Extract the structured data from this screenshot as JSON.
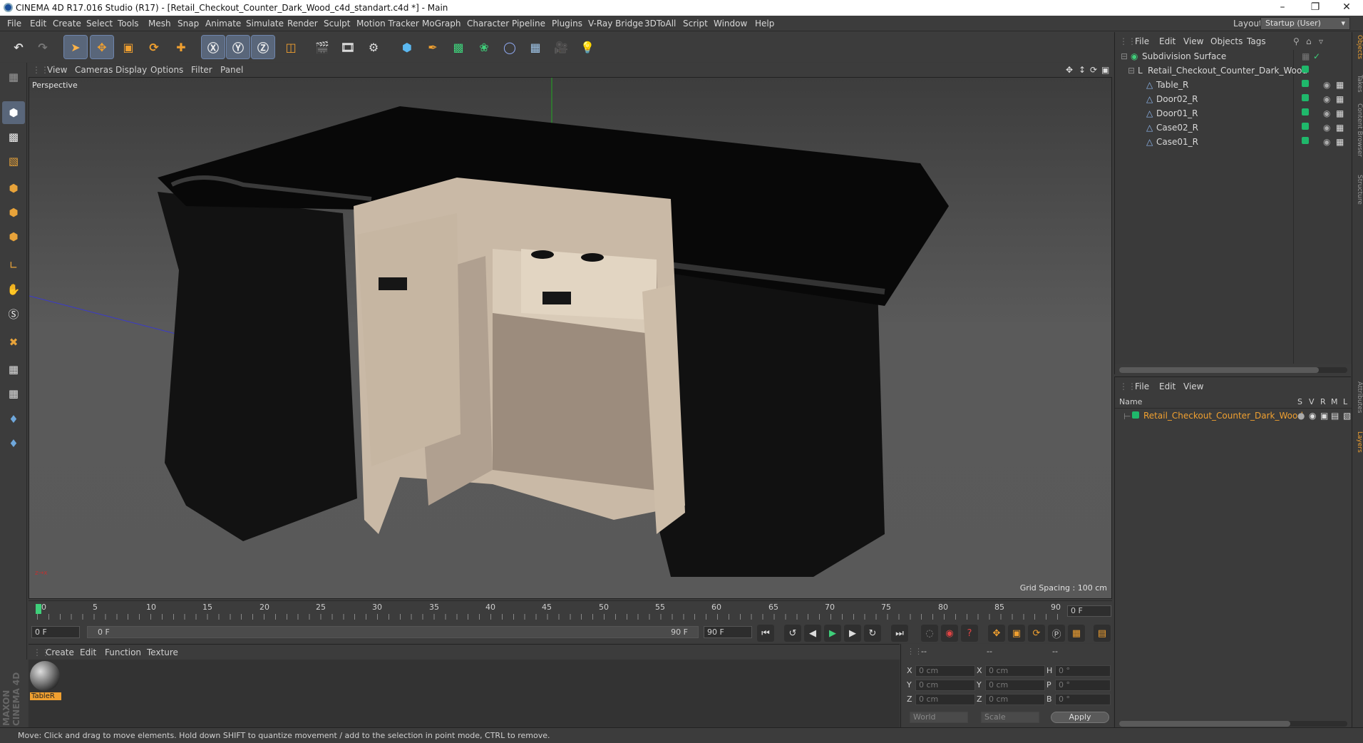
{
  "window": {
    "title": "CINEMA 4D R17.016 Studio (R17) - [Retail_Checkout_Counter_Dark_Wood_c4d_standart.c4d *] - Main"
  },
  "menu": [
    "File",
    "Edit",
    "Create",
    "Select",
    "Tools",
    "Mesh",
    "Snap",
    "Animate",
    "Simulate",
    "Render",
    "Sculpt",
    "Motion Tracker",
    "MoGraph",
    "Character",
    "Pipeline",
    "Plugins",
    "V-Ray Bridge",
    "3DToAll",
    "Script",
    "Window",
    "Help"
  ],
  "layout": {
    "label": "Layout:",
    "value": "Startup (User)"
  },
  "viewport": {
    "menu": [
      "View",
      "Cameras",
      "Display",
      "Options",
      "Filter",
      "Panel"
    ],
    "camera_label": "Perspective",
    "grid_spacing": "Grid Spacing : 100 cm"
  },
  "timeline": {
    "ticks": [
      "0",
      "5",
      "10",
      "15",
      "20",
      "25",
      "30",
      "35",
      "40",
      "45",
      "50",
      "55",
      "60",
      "65",
      "70",
      "75",
      "80",
      "85",
      "90"
    ],
    "current_frame": "0 F"
  },
  "playback": {
    "start": "0 F",
    "range_start": "0 F",
    "range_end": "90 F",
    "end": "90 F"
  },
  "material_panel": {
    "menu": [
      "Create",
      "Edit",
      "Function",
      "Texture"
    ],
    "materials": [
      {
        "name": "TableR"
      }
    ]
  },
  "coordinates": {
    "headers": [
      "--",
      "--",
      "--"
    ],
    "rows": [
      {
        "a": "X",
        "av": "0 cm",
        "b": "X",
        "bv": "0 cm",
        "c": "H",
        "cv": "0 °"
      },
      {
        "a": "Y",
        "av": "0 cm",
        "b": "Y",
        "bv": "0 cm",
        "c": "P",
        "cv": "0 °"
      },
      {
        "a": "Z",
        "av": "0 cm",
        "b": "Z",
        "bv": "0 cm",
        "c": "B",
        "cv": "0 °"
      }
    ],
    "space": "World",
    "mode": "Scale",
    "apply": "Apply"
  },
  "object_manager": {
    "menu": [
      "File",
      "Edit",
      "View",
      "Objects",
      "Tags"
    ],
    "objects": [
      {
        "name": "Subdivision Surface",
        "indent": 0
      },
      {
        "name": "Retail_Checkout_Counter_Dark_Wood",
        "indent": 1
      },
      {
        "name": "Table_R",
        "indent": 2
      },
      {
        "name": "Door02_R",
        "indent": 2
      },
      {
        "name": "Door01_R",
        "indent": 2
      },
      {
        "name": "Case02_R",
        "indent": 2
      },
      {
        "name": "Case01_R",
        "indent": 2
      }
    ]
  },
  "layer_manager": {
    "menu": [
      "File",
      "Edit",
      "View"
    ],
    "columns": [
      "Name",
      "S",
      "V",
      "R",
      "M",
      "L"
    ],
    "layers": [
      {
        "name": "Retail_Checkout_Counter_Dark_Wood"
      }
    ]
  },
  "right_tabs": [
    "Objects",
    "Takes",
    "Content Browser",
    "Structure",
    "Attributes",
    "Layers"
  ],
  "brand": "MAXON CINEMA 4D",
  "status": "Move: Click and drag to move elements. Hold down SHIFT to quantize movement / add to the selection in point mode, CTRL to remove."
}
